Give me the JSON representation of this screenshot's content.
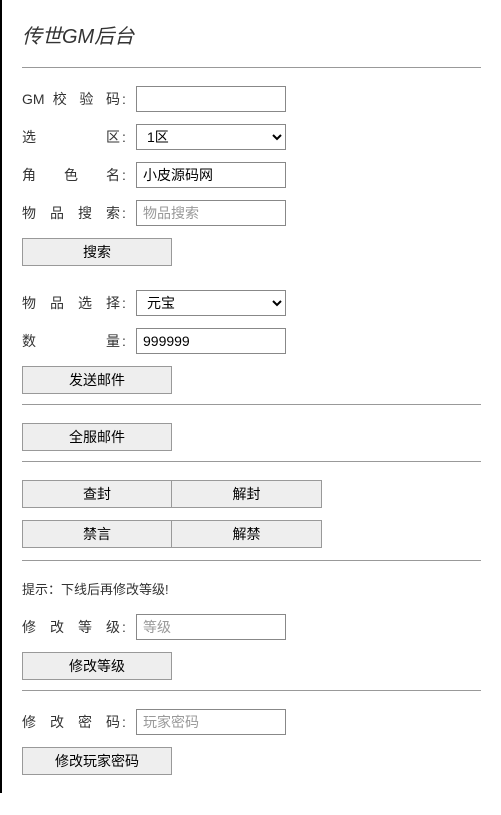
{
  "title": "传世GM后台",
  "fields": {
    "gm_code": {
      "label": "GM 校 验 码",
      "value": ""
    },
    "zone": {
      "label": "选　　　区",
      "selected": "1区",
      "options": [
        "1区"
      ]
    },
    "role_name": {
      "label": "角　色　名",
      "value": "小皮源码网"
    },
    "item_search": {
      "label": "物 品 搜 索",
      "placeholder": "物品搜索",
      "value": ""
    },
    "item_select": {
      "label": "物 品 选 择",
      "selected": "元宝",
      "options": [
        "元宝"
      ]
    },
    "quantity": {
      "label": "数　　　量",
      "value": "999999"
    },
    "level": {
      "label": "修 改 等 级",
      "placeholder": "等级",
      "value": ""
    },
    "password": {
      "label": "修 改 密 码",
      "placeholder": "玩家密码",
      "value": ""
    }
  },
  "buttons": {
    "search": "搜索",
    "send_mail": "发送邮件",
    "all_server_mail": "全服邮件",
    "ban_check": "查封",
    "unban_check": "解封",
    "mute": "禁言",
    "unmute": "解禁",
    "modify_level": "修改等级",
    "modify_password": "修改玩家密码"
  },
  "hint": "提示：下线后再修改等级!",
  "colon": ":"
}
